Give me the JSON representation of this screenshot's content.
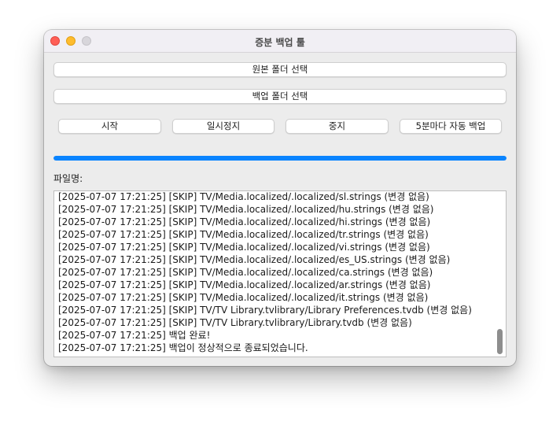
{
  "window": {
    "title": "증분 백업 툴"
  },
  "buttons": {
    "source_folder": "원본 폴더 선택",
    "backup_folder": "백업 폴더 선택",
    "start": "시작",
    "pause": "일시정지",
    "stop": "중지",
    "auto_backup": "5분마다 자동 백업"
  },
  "progress": {
    "value_percent": 100,
    "color": "#0a84ff"
  },
  "filename_label": "파일명:",
  "log": [
    "[2025-07-07 17:21:25] [SKIP] TV/Media.localized/.localized/sl.strings (변경 없음)",
    "[2025-07-07 17:21:25] [SKIP] TV/Media.localized/.localized/hu.strings (변경 없음)",
    "[2025-07-07 17:21:25] [SKIP] TV/Media.localized/.localized/hi.strings (변경 없음)",
    "[2025-07-07 17:21:25] [SKIP] TV/Media.localized/.localized/tr.strings (변경 없음)",
    "[2025-07-07 17:21:25] [SKIP] TV/Media.localized/.localized/vi.strings (변경 없음)",
    "[2025-07-07 17:21:25] [SKIP] TV/Media.localized/.localized/es_US.strings (변경 없음)",
    "[2025-07-07 17:21:25] [SKIP] TV/Media.localized/.localized/ca.strings (변경 없음)",
    "[2025-07-07 17:21:25] [SKIP] TV/Media.localized/.localized/ar.strings (변경 없음)",
    "[2025-07-07 17:21:25] [SKIP] TV/Media.localized/.localized/it.strings (변경 없음)",
    "[2025-07-07 17:21:25] [SKIP] TV/TV Library.tvlibrary/Library Preferences.tvdb (변경 없음)",
    "[2025-07-07 17:21:25] [SKIP] TV/TV Library.tvlibrary/Library.tvdb (변경 없음)",
    "[2025-07-07 17:21:25] 백업 완료!",
    "[2025-07-07 17:21:25] 백업이 정상적으로 종료되었습니다."
  ]
}
